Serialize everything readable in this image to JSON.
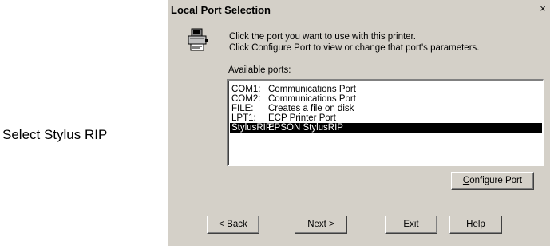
{
  "callout": {
    "text": "Select Stylus RIP"
  },
  "dialog": {
    "title": "Local Port Selection",
    "close_glyph": "×",
    "instruction_line1": "Click the port you want to use with this printer.",
    "instruction_line2": "Click Configure Port to view or change that port's parameters.",
    "available_label": "Available ports:",
    "ports": [
      {
        "name": "COM1:",
        "description": "Communications Port",
        "selected": false
      },
      {
        "name": "COM2:",
        "description": "Communications Port",
        "selected": false
      },
      {
        "name": "FILE:",
        "description": "Creates a file on disk",
        "selected": false
      },
      {
        "name": "LPT1:",
        "description": "ECP Printer Port",
        "selected": false
      },
      {
        "name": "StylusRIP:",
        "description": "EPSON StylusRIP",
        "selected": true
      }
    ],
    "buttons": {
      "configure": {
        "mnemonic": "C",
        "rest": "onfigure Port"
      },
      "back": {
        "pre": "< ",
        "mnemonic": "B",
        "rest": "ack"
      },
      "next": {
        "mnemonic": "N",
        "rest": "ext >"
      },
      "exit": {
        "mnemonic": "E",
        "rest": "xit"
      },
      "help": {
        "mnemonic": "H",
        "rest": "elp"
      }
    }
  },
  "icons": {
    "printer": "printer-icon",
    "close": "close-icon"
  },
  "colors": {
    "dialog_bg": "#d4d0c8",
    "selection_bg": "#000000",
    "selection_fg": "#ffffff"
  }
}
